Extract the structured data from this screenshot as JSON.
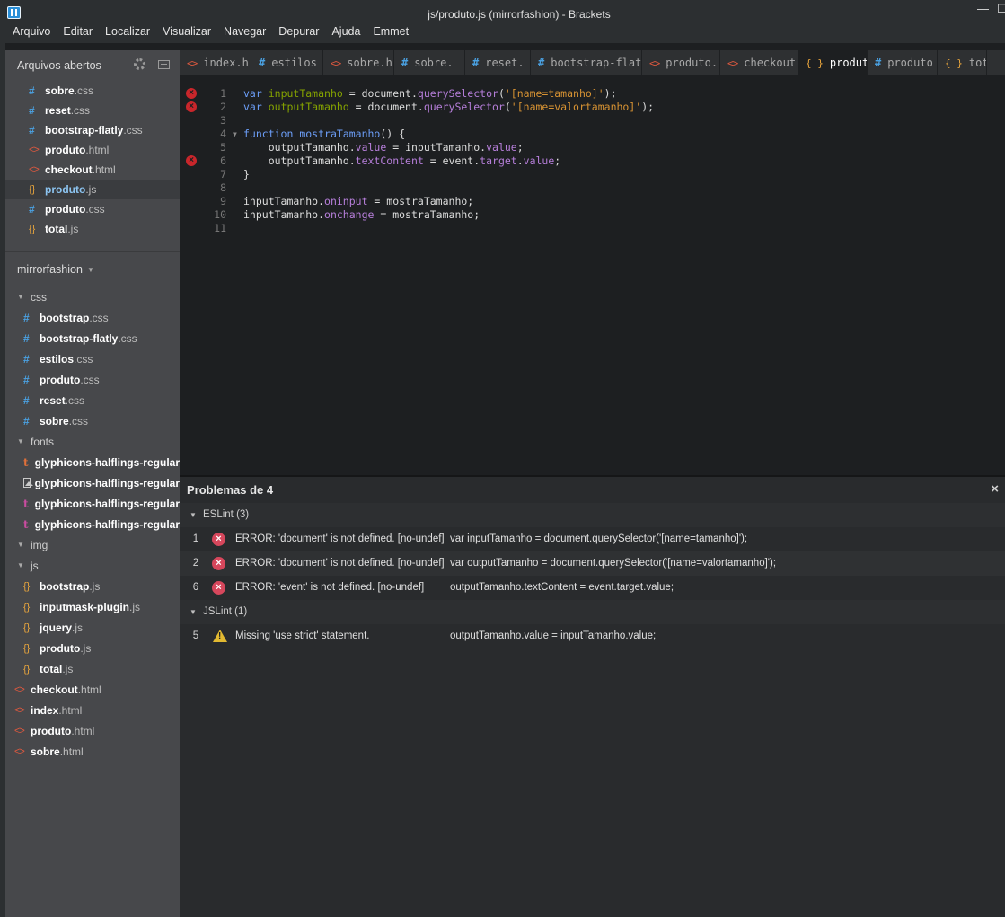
{
  "window": {
    "title": "js/produto.js (mirrorfashion) - Brackets",
    "minimize": "—",
    "restore": "☐"
  },
  "menu": [
    "Arquivo",
    "Editar",
    "Localizar",
    "Visualizar",
    "Navegar",
    "Depurar",
    "Ajuda",
    "Emmet"
  ],
  "sidebar": {
    "open_files_title": "Arquivos abertos",
    "open_files": [
      {
        "name": "sobre",
        "ext": ".css",
        "type": "css"
      },
      {
        "name": "reset",
        "ext": ".css",
        "type": "css"
      },
      {
        "name": "bootstrap-flatly",
        "ext": ".css",
        "type": "css"
      },
      {
        "name": "produto",
        "ext": ".html",
        "type": "html"
      },
      {
        "name": "checkout",
        "ext": ".html",
        "type": "html"
      },
      {
        "name": "produto",
        "ext": ".js",
        "type": "js"
      },
      {
        "name": "produto",
        "ext": ".css",
        "type": "css"
      },
      {
        "name": "total",
        "ext": ".js",
        "type": "js"
      }
    ],
    "project_name": "mirrorfashion",
    "tree": {
      "css_folder": "css",
      "css": [
        {
          "name": "bootstrap",
          "ext": ".css"
        },
        {
          "name": "bootstrap-flatly",
          "ext": ".css"
        },
        {
          "name": "estilos",
          "ext": ".css"
        },
        {
          "name": "produto",
          "ext": ".css"
        },
        {
          "name": "reset",
          "ext": ".css"
        },
        {
          "name": "sobre",
          "ext": ".css"
        }
      ],
      "fonts_folder": "fonts",
      "fonts": [
        {
          "name": "glyphicons-halflings-regular",
          "icon": "ttf"
        },
        {
          "name": "glyphicons-halflings-regular",
          "icon": "image"
        },
        {
          "name": "glyphicons-halflings-regular",
          "icon": "svg"
        },
        {
          "name": "glyphicons-halflings-regular",
          "icon": "svg"
        }
      ],
      "img_folder": "img",
      "js_folder": "js",
      "js": [
        {
          "name": "bootstrap",
          "ext": ".js"
        },
        {
          "name": "inputmask-plugin",
          "ext": ".js"
        },
        {
          "name": "jquery",
          "ext": ".js"
        },
        {
          "name": "produto",
          "ext": ".js"
        },
        {
          "name": "total",
          "ext": ".js"
        }
      ],
      "root_files": [
        {
          "name": "checkout",
          "ext": ".html"
        },
        {
          "name": "index",
          "ext": ".html"
        },
        {
          "name": "produto",
          "ext": ".html"
        },
        {
          "name": "sobre",
          "ext": ".html"
        }
      ]
    }
  },
  "tabs": [
    {
      "icon": "<>",
      "label": "index.h",
      "type": "html"
    },
    {
      "icon": "#",
      "label": "estilos",
      "type": "css"
    },
    {
      "icon": "<>",
      "label": "sobre.h",
      "type": "html"
    },
    {
      "icon": "#",
      "label": "sobre.",
      "type": "css"
    },
    {
      "icon": "#",
      "label": "reset.",
      "type": "css"
    },
    {
      "icon": "#",
      "label": "bootstrap-flat",
      "type": "css"
    },
    {
      "icon": "<>",
      "label": "produto.",
      "type": "html"
    },
    {
      "icon": "<>",
      "label": "checkout.",
      "type": "html"
    },
    {
      "icon": "{ }",
      "label": "produto",
      "type": "js",
      "active": true
    },
    {
      "icon": "#",
      "label": "produto",
      "type": "css"
    },
    {
      "icon": "{ }",
      "label": "total",
      "type": "js"
    }
  ],
  "code": {
    "error_lines": [
      1,
      2,
      6
    ],
    "fold_line": 4,
    "lines": [
      "var inputTamanho = document.querySelector('[name=tamanho]');",
      "var outputTamanho = document.querySelector('[name=valortamanho]');",
      "",
      "function mostraTamanho() {",
      "    outputTamanho.value = inputTamanho.value;",
      "    outputTamanho.textContent = event.target.value;",
      "}",
      "",
      "inputTamanho.oninput = mostraTamanho;",
      "inputTamanho.onchange = mostraTamanho;",
      ""
    ]
  },
  "problems": {
    "title": "Problemas de 4",
    "close": "×",
    "groups": [
      {
        "name": "ESLint (3)",
        "items": [
          {
            "line": "1",
            "severity": "error",
            "message": "ERROR: 'document' is not defined. [no-undef]",
            "code": "var inputTamanho = document.querySelector('[name=tamanho]');"
          },
          {
            "line": "2",
            "severity": "error",
            "message": "ERROR: 'document' is not defined. [no-undef]",
            "code": "var outputTamanho = document.querySelector('[name=valortamanho]');"
          },
          {
            "line": "6",
            "severity": "error",
            "message": "ERROR: 'event' is not defined. [no-undef]",
            "code": "outputTamanho.textContent = event.target.value;"
          }
        ]
      },
      {
        "name": "JSLint (1)",
        "items": [
          {
            "line": "5",
            "severity": "warning",
            "message": "Missing 'use strict' statement.",
            "code": "outputTamanho.value = inputTamanho.value;"
          }
        ]
      }
    ]
  },
  "colors": {
    "css_icon": "#4aa1e2",
    "html_icon": "#e0593f",
    "js_icon": "#e8a53d",
    "error": "#d6475c",
    "warning": "#e2b931"
  }
}
